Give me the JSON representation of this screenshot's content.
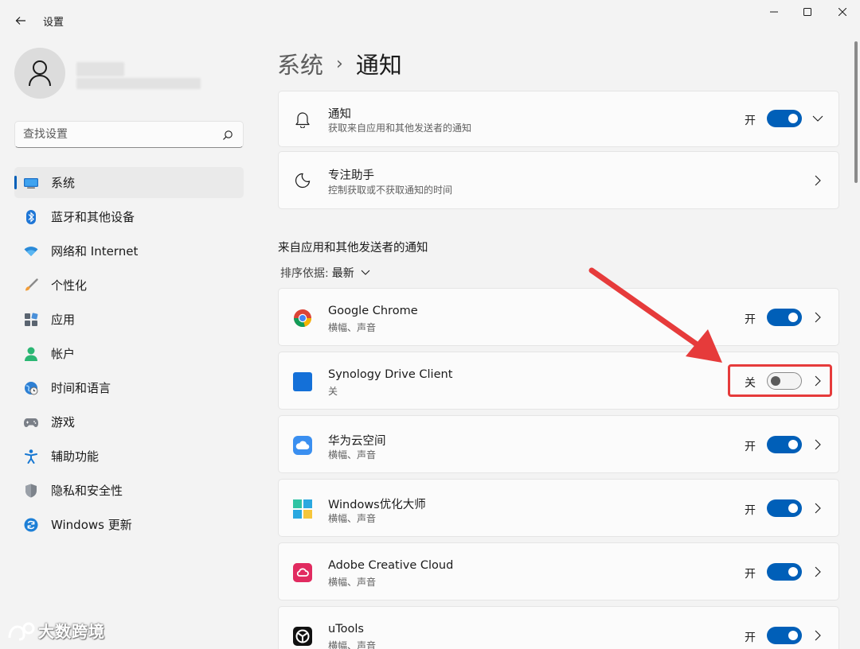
{
  "window": {
    "title": "设置"
  },
  "profile": {
    "name_hidden": true
  },
  "search": {
    "placeholder": "查找设置"
  },
  "sidebar": {
    "items": [
      {
        "label": "系统",
        "icon": "monitor-icon",
        "active": true
      },
      {
        "label": "蓝牙和其他设备",
        "icon": "bluetooth-icon"
      },
      {
        "label": "网络和 Internet",
        "icon": "wifi-icon"
      },
      {
        "label": "个性化",
        "icon": "brush-icon"
      },
      {
        "label": "应用",
        "icon": "apps-icon"
      },
      {
        "label": "帐户",
        "icon": "person-icon"
      },
      {
        "label": "时间和语言",
        "icon": "globe-clock-icon"
      },
      {
        "label": "游戏",
        "icon": "gamepad-icon"
      },
      {
        "label": "辅助功能",
        "icon": "accessibility-icon"
      },
      {
        "label": "隐私和安全性",
        "icon": "shield-icon"
      },
      {
        "label": "Windows 更新",
        "icon": "update-icon"
      }
    ]
  },
  "breadcrumb": {
    "parent": "系统",
    "separator": "›",
    "current": "通知"
  },
  "top_cards": [
    {
      "title": "通知",
      "subtitle": "获取来自应用和其他发送者的通知",
      "toggle_label": "开",
      "toggle_on": true,
      "icon": "bell-icon"
    },
    {
      "title": "专注助手",
      "subtitle": "控制获取或不获取通知的时间",
      "icon": "moon-icon"
    }
  ],
  "section": {
    "title": "来自应用和其他发送者的通知",
    "sort_label": "排序依据:",
    "sort_value": "最新"
  },
  "apps": [
    {
      "name": "Google Chrome",
      "subtitle": "横幅、声音",
      "toggle_label": "开",
      "toggle_on": true,
      "icon": "chrome-icon"
    },
    {
      "name": "Synology Drive Client",
      "subtitle": "关",
      "toggle_label": "关",
      "toggle_on": false,
      "icon": "synology-icon"
    },
    {
      "name": "华为云空间",
      "subtitle": "横幅、声音",
      "toggle_label": "开",
      "toggle_on": true,
      "icon": "huawei-cloud-icon"
    },
    {
      "name": "Windows优化大师",
      "subtitle": "横幅、声音",
      "toggle_label": "开",
      "toggle_on": true,
      "icon": "windows-optimizer-icon"
    },
    {
      "name": "Adobe Creative Cloud",
      "subtitle": "横幅、声音",
      "toggle_label": "开",
      "toggle_on": true,
      "icon": "adobe-cc-icon"
    },
    {
      "name": "uTools",
      "subtitle": "横幅、声音",
      "toggle_label": "开",
      "toggle_on": true,
      "icon": "utools-icon"
    }
  ],
  "watermark": "大数跨境",
  "colors": {
    "accent": "#005fb8",
    "highlight": "#e63b3b"
  }
}
